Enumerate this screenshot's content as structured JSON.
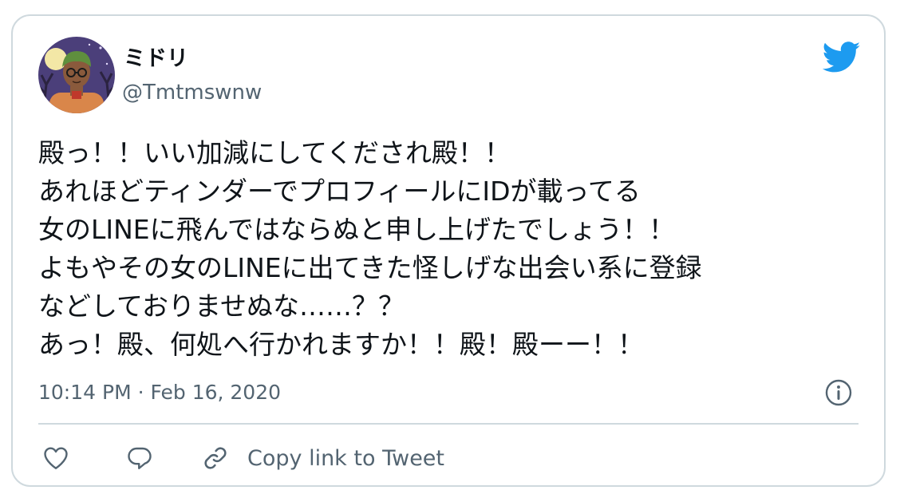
{
  "author": {
    "display_name": "ミドリ",
    "handle": "@Tmtmswnw",
    "avatar_icon": "avatar-illustration"
  },
  "tweet": {
    "lines": [
      "殿っ！！いい加減にしてくだされ殿！！",
      "あれほどティンダーでプロフィールにIDが載ってる",
      "女のLINEに飛んではならぬと申し上げたでしょう！！",
      "よもやその女のLINEに出てきた怪しげな出会い系に登録",
      "などしておりませぬな……？？",
      "あっ！殿、何処へ行かれますか！！殿！殿ーー！！"
    ],
    "timestamp": "10:14 PM · Feb 16, 2020"
  },
  "actions": {
    "like_icon": "heart-icon",
    "reply_icon": "reply-icon",
    "copy_link_icon": "link-icon",
    "copy_link_label": "Copy link to Tweet"
  },
  "colors": {
    "brand": "#1d9bf0",
    "text_primary": "#0f1419",
    "text_secondary": "#536471",
    "border": "#cfd9de"
  }
}
